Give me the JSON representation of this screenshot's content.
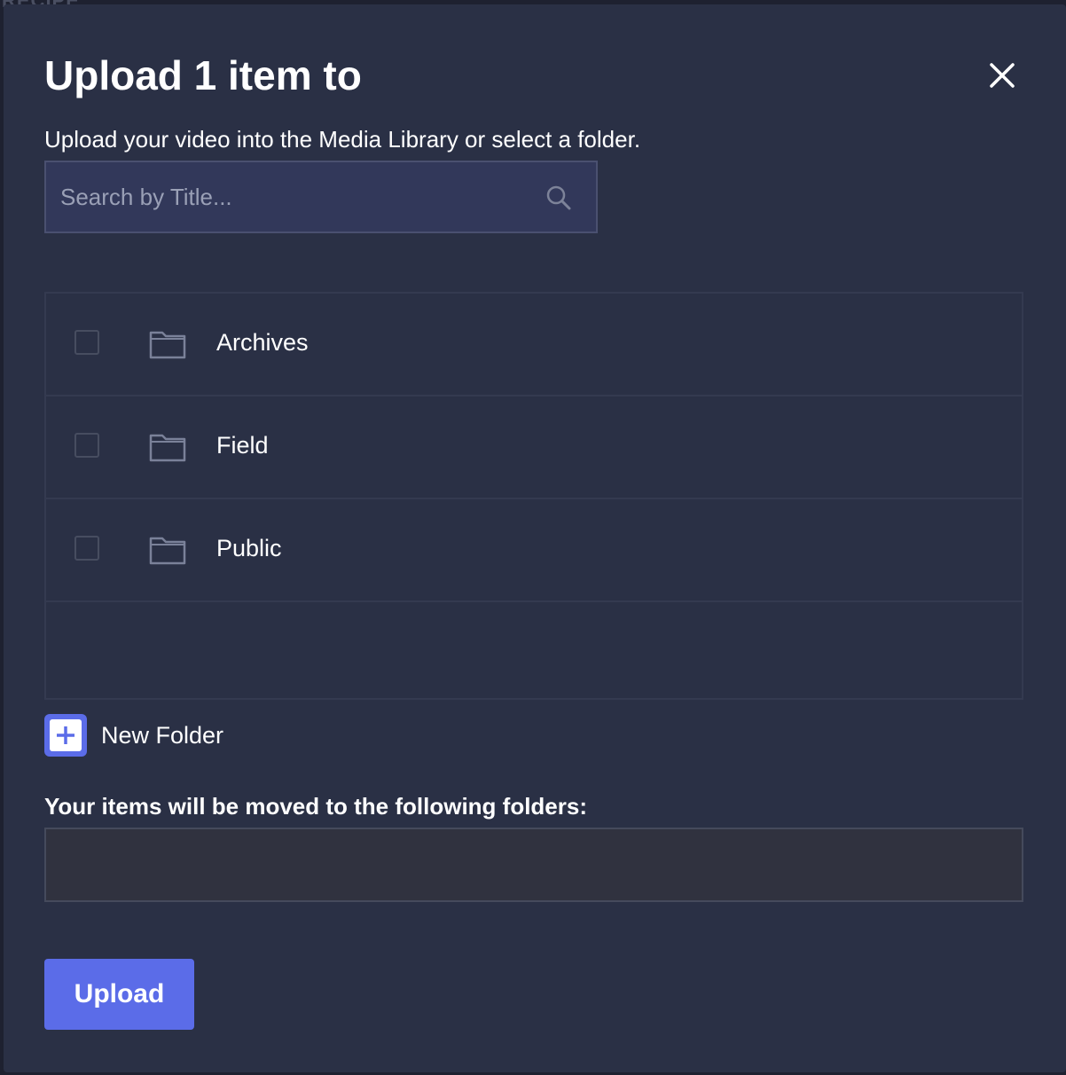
{
  "modal": {
    "title": "Upload 1 item to",
    "subtitle": "Upload your video into the Media Library or select a folder.",
    "close_icon": "close-icon"
  },
  "search": {
    "placeholder": "Search by Title...",
    "value": "",
    "icon": "search-icon"
  },
  "folders": [
    {
      "name": "Archives",
      "checked": false,
      "icon": "folder-icon"
    },
    {
      "name": "Field",
      "checked": false,
      "icon": "folder-icon"
    },
    {
      "name": "Public",
      "checked": false,
      "icon": "folder-icon"
    }
  ],
  "new_folder": {
    "label": "New Folder",
    "icon": "plus-icon"
  },
  "destination": {
    "label": "Your items will be moved to the following folders:",
    "value": ""
  },
  "upload_button": {
    "label": "Upload"
  },
  "colors": {
    "modal_background": "#2a3045",
    "accent": "#5b6ce8",
    "text": "#ffffff",
    "placeholder": "#9aa0b6"
  }
}
